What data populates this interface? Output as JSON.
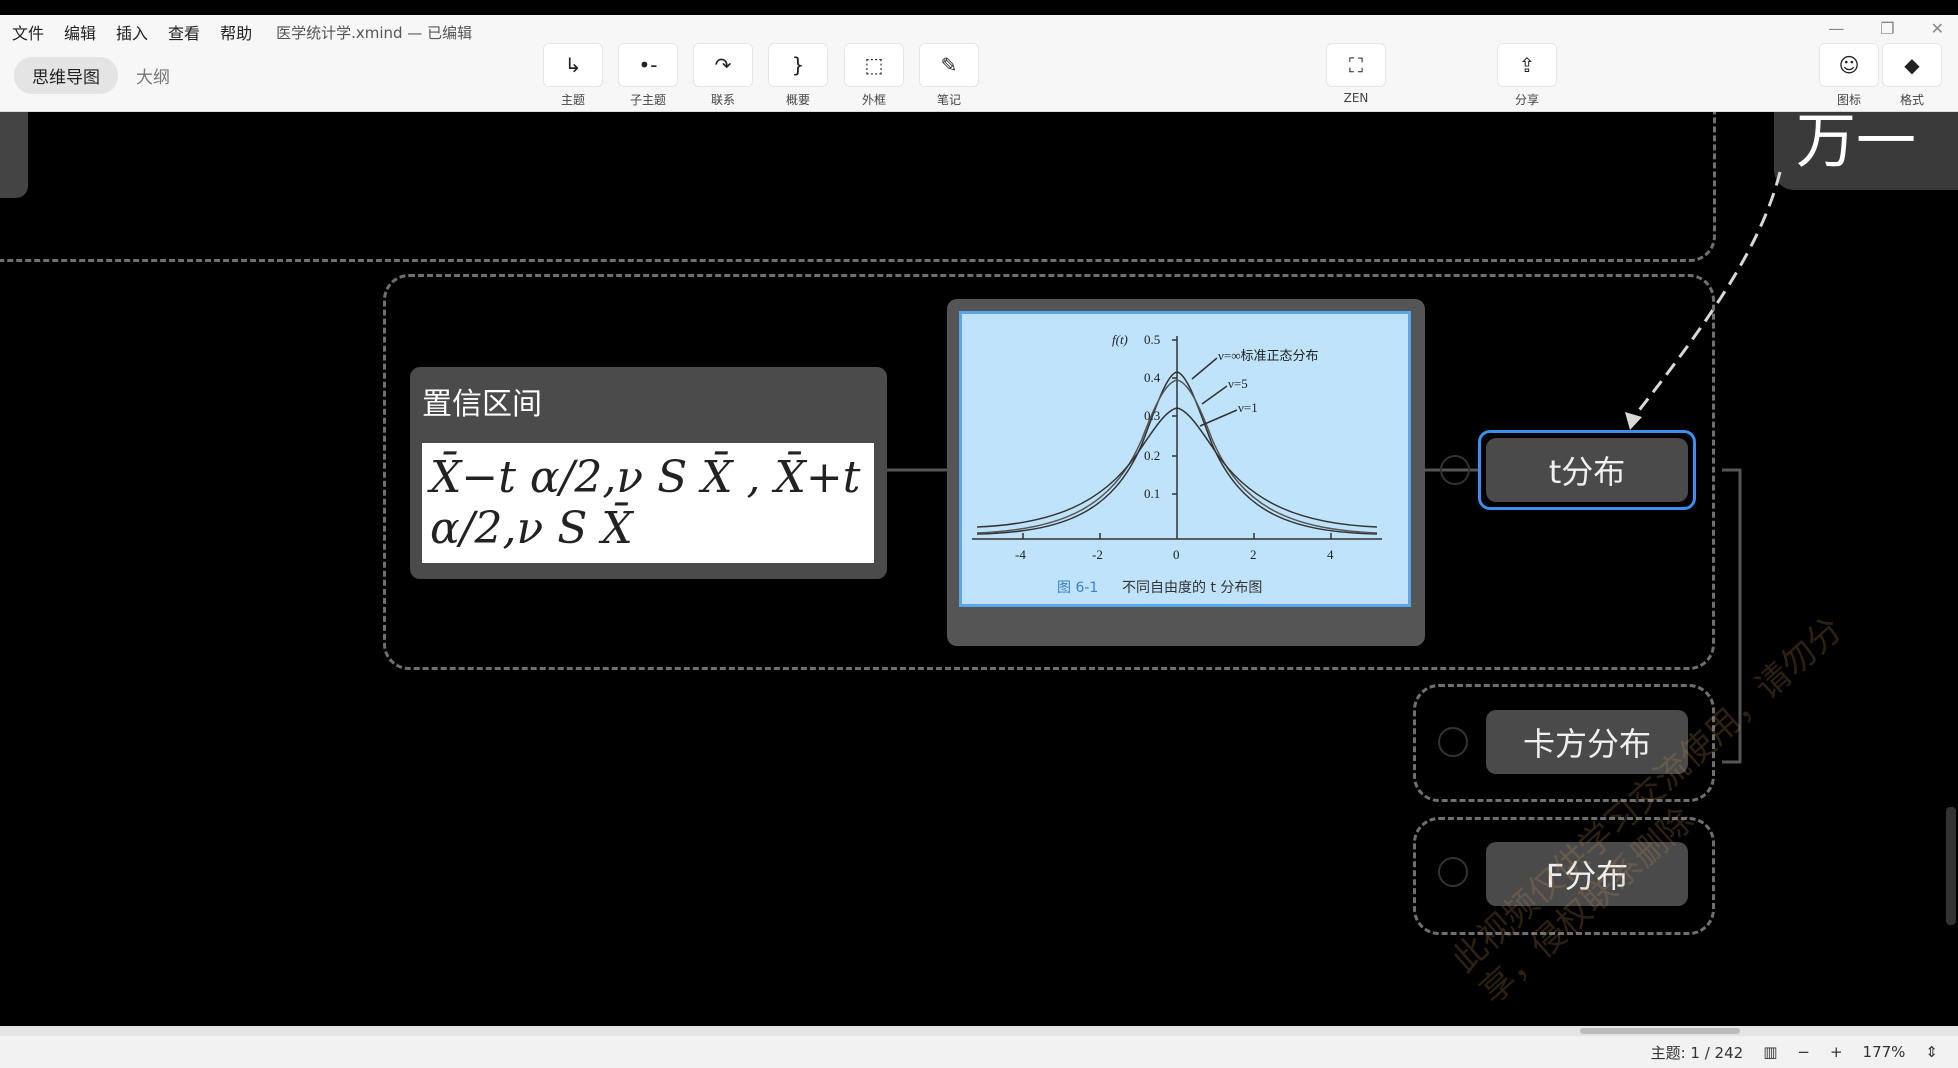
{
  "menu": {
    "items": [
      "文件",
      "编辑",
      "插入",
      "查看",
      "帮助"
    ],
    "document_title": "医学统计学.xmind — 已编辑"
  },
  "modes": {
    "active": "思维导图",
    "other": "大纲"
  },
  "toolbar": [
    {
      "label": "主题",
      "icon": "topic-icon",
      "glyph": "↳"
    },
    {
      "label": "子主题",
      "icon": "subtopic-icon",
      "glyph": "•-"
    },
    {
      "label": "联系",
      "icon": "relationship-icon",
      "glyph": "↷"
    },
    {
      "label": "概要",
      "icon": "summary-icon",
      "glyph": "}"
    },
    {
      "label": "外框",
      "icon": "boundary-icon",
      "glyph": "⬚"
    },
    {
      "label": "笔记",
      "icon": "note-icon",
      "glyph": "✎"
    },
    {
      "label": "ZEN",
      "icon": "zen-icon",
      "glyph": "⛶"
    },
    {
      "label": "分享",
      "icon": "share-icon",
      "glyph": "⇪"
    },
    {
      "label": "图标",
      "icon": "emoji-icon",
      "glyph": "☺"
    },
    {
      "label": "格式",
      "icon": "format-icon",
      "glyph": "◆"
    }
  ],
  "window": {
    "minimize": "—",
    "restore": "❐",
    "close": "✕"
  },
  "canvas": {
    "formula_node": {
      "title": "置信区间",
      "formula": "X̄−t α/2,ν S X̄ , X̄+t α/2,ν S X̄"
    },
    "image_node": {
      "y_axis_label": "f(t)",
      "y_ticks": [
        "0.5",
        "0.4",
        "0.3",
        "0.2",
        "0.1"
      ],
      "x_ticks": [
        "-4",
        "-2",
        "0",
        "2",
        "4"
      ],
      "curve_labels": [
        "ν=∞标准正态分布",
        "ν=5",
        "ν=1"
      ],
      "caption_number": "图 6-1",
      "caption_text": "不同自由度的 t 分布图"
    },
    "t_node": "t分布",
    "chi_node": "卡方分布",
    "f_node": "F分布",
    "partial_right_text": "万一"
  },
  "watermark": "此视频仅供学习交流使用，请勿分享，侵权联系删除",
  "status": {
    "topic_count": "主题: 1 / 242",
    "zoom": "177%"
  }
}
